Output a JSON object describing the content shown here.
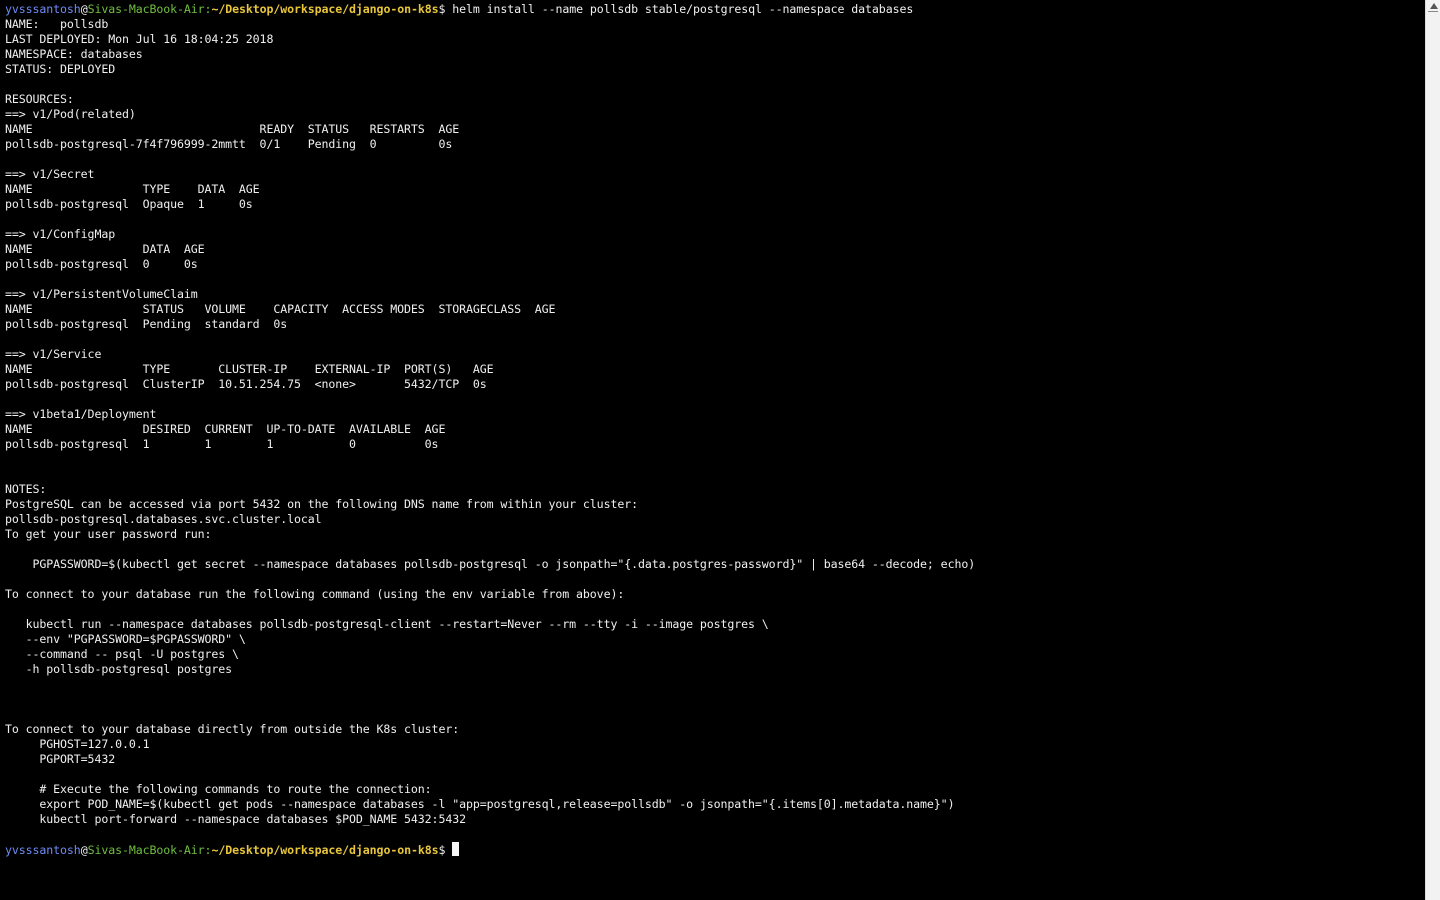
{
  "prompt": {
    "user": "yvsssantosh",
    "at": "@",
    "host": "Sivas-MacBook-Air",
    "colon": ":",
    "path": "~/Desktop/workspace/django-on-k8s",
    "symbol": "$ "
  },
  "command": "helm install --name pollsdb stable/postgresql --namespace databases",
  "output_lines": [
    "NAME:   pollsdb",
    "LAST DEPLOYED: Mon Jul 16 18:04:25 2018",
    "NAMESPACE: databases",
    "STATUS: DEPLOYED",
    "",
    "RESOURCES:",
    "==> v1/Pod(related)",
    "NAME                                 READY  STATUS   RESTARTS  AGE",
    "pollsdb-postgresql-7f4f796999-2mmtt  0/1    Pending  0         0s",
    "",
    "==> v1/Secret",
    "NAME                TYPE    DATA  AGE",
    "pollsdb-postgresql  Opaque  1     0s",
    "",
    "==> v1/ConfigMap",
    "NAME                DATA  AGE",
    "pollsdb-postgresql  0     0s",
    "",
    "==> v1/PersistentVolumeClaim",
    "NAME                STATUS   VOLUME    CAPACITY  ACCESS MODES  STORAGECLASS  AGE",
    "pollsdb-postgresql  Pending  standard  0s",
    "",
    "==> v1/Service",
    "NAME                TYPE       CLUSTER-IP    EXTERNAL-IP  PORT(S)   AGE",
    "pollsdb-postgresql  ClusterIP  10.51.254.75  <none>       5432/TCP  0s",
    "",
    "==> v1beta1/Deployment",
    "NAME                DESIRED  CURRENT  UP-TO-DATE  AVAILABLE  AGE",
    "pollsdb-postgresql  1        1        1           0          0s",
    "",
    "",
    "NOTES:",
    "PostgreSQL can be accessed via port 5432 on the following DNS name from within your cluster:",
    "pollsdb-postgresql.databases.svc.cluster.local",
    "To get your user password run:",
    "",
    "    PGPASSWORD=$(kubectl get secret --namespace databases pollsdb-postgresql -o jsonpath=\"{.data.postgres-password}\" | base64 --decode; echo)",
    "",
    "To connect to your database run the following command (using the env variable from above):",
    "",
    "   kubectl run --namespace databases pollsdb-postgresql-client --restart=Never --rm --tty -i --image postgres \\",
    "   --env \"PGPASSWORD=$PGPASSWORD\" \\",
    "   --command -- psql -U postgres \\",
    "   -h pollsdb-postgresql postgres",
    "",
    "",
    "",
    "To connect to your database directly from outside the K8s cluster:",
    "     PGHOST=127.0.0.1",
    "     PGPORT=5432",
    "",
    "     # Execute the following commands to route the connection:",
    "     export POD_NAME=$(kubectl get pods --namespace databases -l \"app=postgresql,release=pollsdb\" -o jsonpath=\"{.items[0].metadata.name}\")",
    "     kubectl port-forward --namespace databases $POD_NAME 5432:5432",
    ""
  ],
  "colors": {
    "background": "#000000",
    "text": "#f0f0f0",
    "user": "#6f8cf6",
    "host": "#6fbf3f",
    "path": "#e8c63c"
  }
}
